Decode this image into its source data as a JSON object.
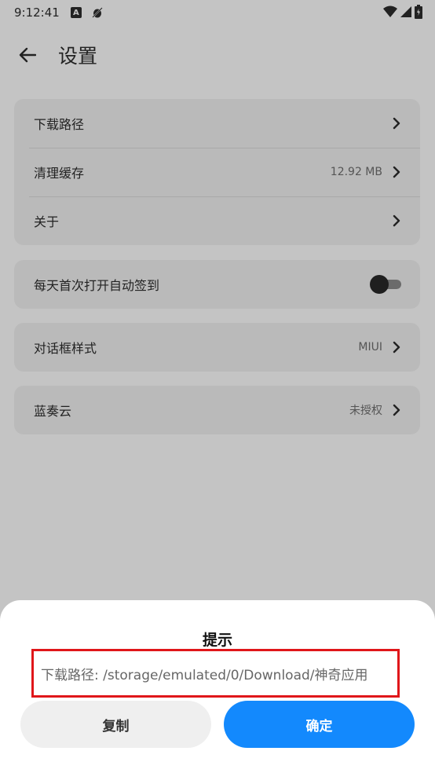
{
  "status_bar": {
    "time": "9:12:41",
    "left_icons": [
      "a-badge-icon",
      "bug-icon"
    ],
    "right_icons": [
      "wifi-icon",
      "signal-icon",
      "battery-icon"
    ]
  },
  "header": {
    "title": "设置",
    "back_icon": "arrow-left-icon"
  },
  "groups": [
    {
      "rows": [
        {
          "label": "下载路径",
          "value": ""
        },
        {
          "label": "清理缓存",
          "value": "12.92 MB"
        },
        {
          "label": "关于",
          "value": ""
        }
      ]
    },
    {
      "rows": [
        {
          "label": "每天首次打开自动签到",
          "toggle": false
        }
      ]
    },
    {
      "rows": [
        {
          "label": "对话框样式",
          "value": "MIUI"
        }
      ]
    },
    {
      "rows": [
        {
          "label": "蓝奏云",
          "value": "未授权"
        }
      ]
    }
  ],
  "dialog": {
    "title": "提示",
    "message": "下载路径: /storage/emulated/0/Download/神奇应用",
    "copy_label": "复制",
    "confirm_label": "确定"
  },
  "colors": {
    "accent": "#1389fd",
    "highlight_border": "#e0161a",
    "scrim_background": "#c4c4c4",
    "card_background": "#bababa"
  }
}
